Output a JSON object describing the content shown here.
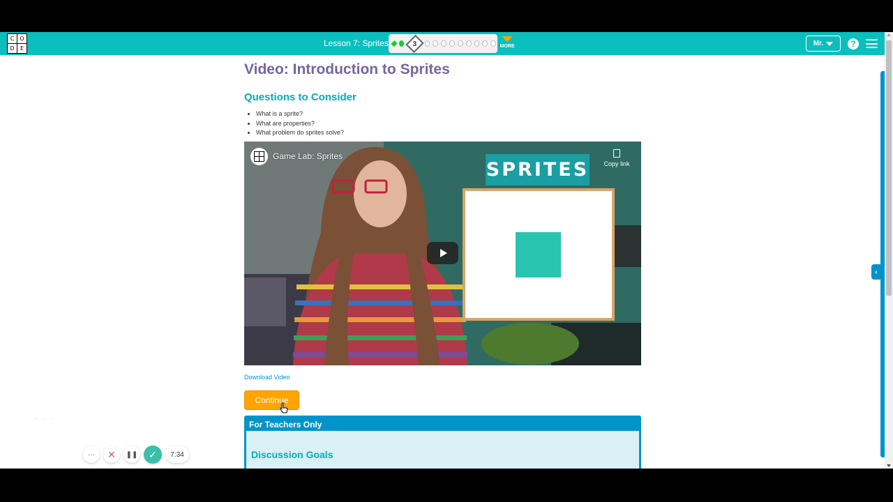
{
  "header": {
    "logo_letters": [
      "C",
      "O",
      "D",
      "E"
    ],
    "lesson_title": "Lesson 7: Sprites",
    "current_step": "3",
    "more_label": "MORE",
    "user_label": "Mr.",
    "help_label": "?"
  },
  "content": {
    "title": "Video: Introduction to Sprites",
    "questions_heading": "Questions to Consider",
    "questions": [
      "What is a sprite?",
      "What are properties?",
      "What problem do sprites solve?"
    ],
    "video_title": "Game Lab: Sprites",
    "copy_link_label": "Copy link",
    "sprites_sign": "SPRITES",
    "download_label": "Download Video",
    "continue_label": "Continue"
  },
  "teacher_panel": {
    "header": "For Teachers Only",
    "heading": "Discussion Goals"
  },
  "controls": {
    "more_label": "···",
    "time": "7:34"
  },
  "colors": {
    "brand_teal": "#0bbfbe",
    "title_purple": "#7665a0",
    "heading_teal": "#00adbc",
    "continue_orange": "#ffa400",
    "teacher_blue": "#0094ca"
  }
}
